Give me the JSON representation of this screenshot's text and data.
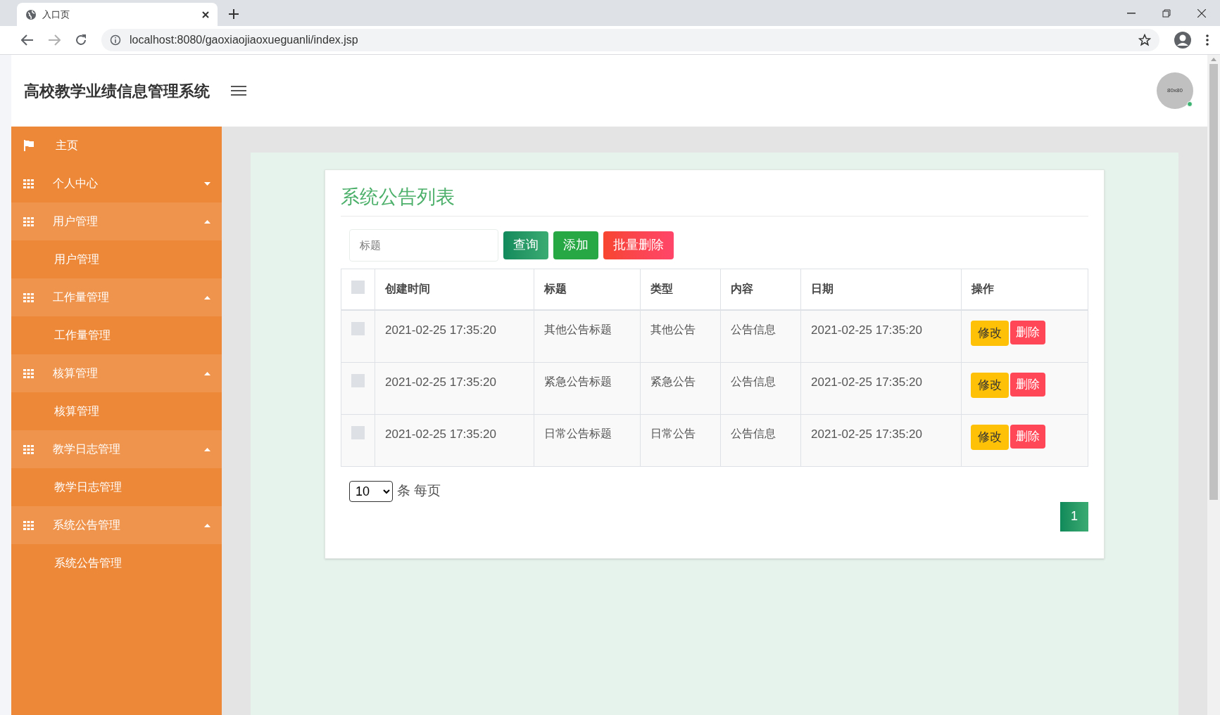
{
  "browser": {
    "tab_title": "入口页",
    "url": "localhost:8080/gaoxiaojiaoxueguanli/index.jsp"
  },
  "header": {
    "title": "高校教学业绩信息管理系统",
    "avatar_label": "80x80"
  },
  "sidebar": {
    "items": [
      {
        "label": "主页",
        "kind": "home"
      },
      {
        "label": "个人中心",
        "kind": "menu",
        "expanded": false
      },
      {
        "label": "用户管理",
        "kind": "menu",
        "expanded": true,
        "children": [
          {
            "label": "用户管理"
          }
        ]
      },
      {
        "label": "工作量管理",
        "kind": "menu",
        "expanded": true,
        "children": [
          {
            "label": "工作量管理"
          }
        ]
      },
      {
        "label": "核算管理",
        "kind": "menu",
        "expanded": true,
        "children": [
          {
            "label": "核算管理"
          }
        ]
      },
      {
        "label": "教学日志管理",
        "kind": "menu",
        "expanded": true,
        "children": [
          {
            "label": "教学日志管理"
          }
        ]
      },
      {
        "label": "系统公告管理",
        "kind": "menu",
        "expanded": true,
        "children": [
          {
            "label": "系统公告管理"
          }
        ]
      }
    ]
  },
  "panel": {
    "title": "系统公告列表",
    "search": {
      "placeholder": "标题"
    },
    "buttons": [
      {
        "label": "查询",
        "kind": "search"
      },
      {
        "label": "添加",
        "kind": "add"
      },
      {
        "label": "批量删除",
        "kind": "delete"
      }
    ],
    "table": {
      "columns": [
        "创建时间",
        "标题",
        "类型",
        "内容",
        "日期",
        "操作"
      ],
      "rows": [
        {
          "checked": false,
          "cells": [
            "2021-02-25 17:35:20",
            "其他公告标题",
            "其他公告",
            "公告信息",
            "2021-02-25 17:35:20"
          ],
          "actions": [
            "修改",
            "删除"
          ]
        },
        {
          "checked": false,
          "cells": [
            "2021-02-25 17:35:20",
            "紧急公告标题",
            "紧急公告",
            "公告信息",
            "2021-02-25 17:35:20"
          ],
          "actions": [
            "修改",
            "删除"
          ]
        },
        {
          "checked": false,
          "cells": [
            "2021-02-25 17:35:20",
            "日常公告标题",
            "日常公告",
            "公告信息",
            "2021-02-25 17:35:20"
          ],
          "actions": [
            "修改",
            "删除"
          ]
        }
      ],
      "header_checked": false
    },
    "page_size": "10",
    "page_size_suffix": "条 每页",
    "pages": [
      {
        "label": "1",
        "selected": true
      }
    ]
  }
}
